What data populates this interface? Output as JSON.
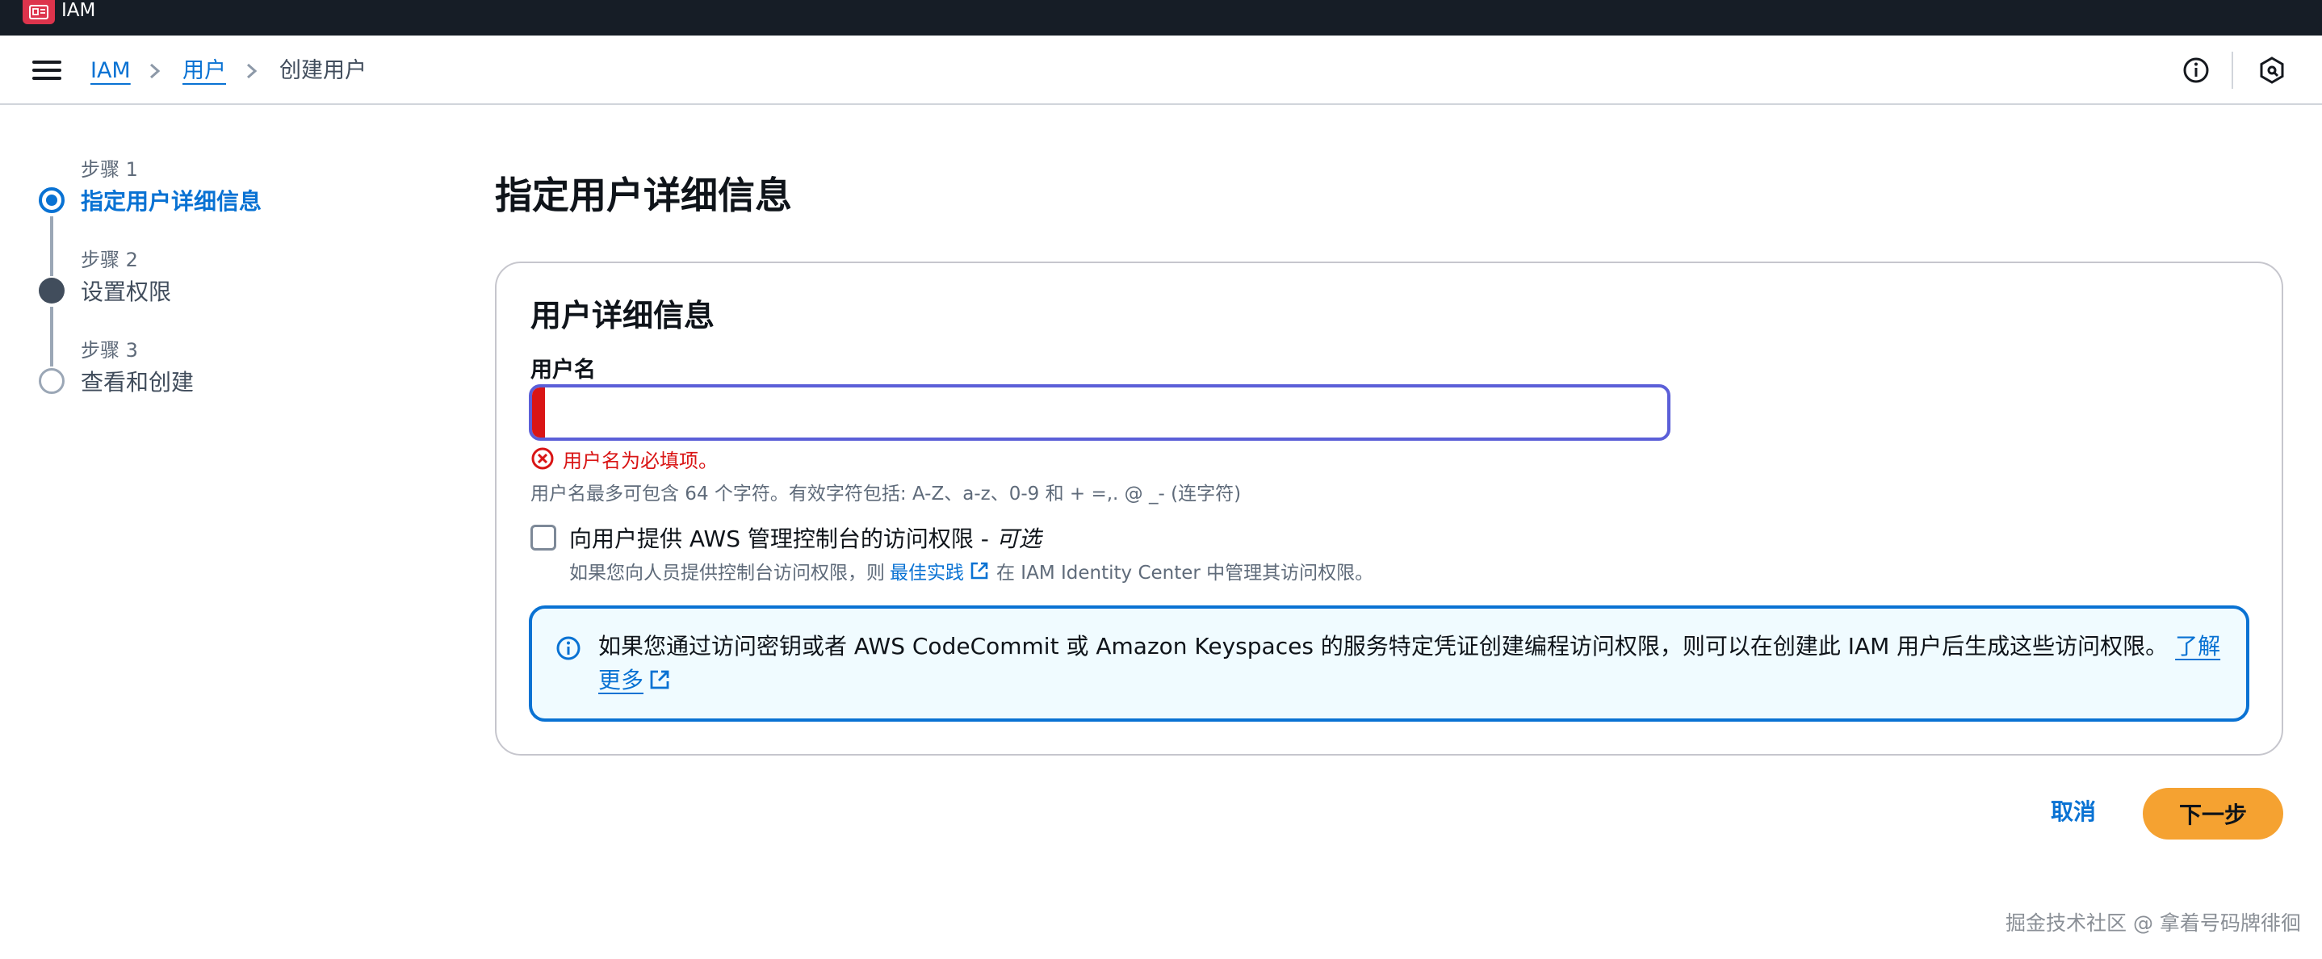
{
  "app": {
    "name": "IAM",
    "logo_icon": "iam-logo-icon"
  },
  "breadcrumb": {
    "items": [
      "IAM",
      "用户"
    ],
    "current": "创建用户"
  },
  "steps": [
    {
      "number": "步骤 1",
      "label": "指定用户详细信息",
      "state": "active"
    },
    {
      "number": "步骤 2",
      "label": "设置权限",
      "state": "visited"
    },
    {
      "number": "步骤 3",
      "label": "查看和创建",
      "state": "pending"
    }
  ],
  "page_title": "指定用户详细信息",
  "container": {
    "title": "用户详细信息",
    "username_label": "用户名",
    "username_value": "",
    "error_text": "用户名为必填项。",
    "constraint_text": "用户名最多可包含 64 个字符。有效字符包括: A-Z、a-z、0-9 和 + =,. @ _- (连字符)",
    "console_access_label": "向用户提供 AWS 管理控制台的访问权限 - ",
    "console_access_optional": "可选",
    "console_access_desc_before": "如果您向人员提供控制台访问权限，则",
    "console_access_link": "最佳实践",
    "console_access_desc_after": "在 IAM Identity Center 中管理其访问权限。",
    "info_text": "如果您通过访问密钥或者 AWS CodeCommit 或 Amazon Keyspaces 的服务特定凭证创建编程访问权限，则可以在创建此 IAM 用户后生成这些访问权限。",
    "info_link": "了解更多"
  },
  "actions": {
    "cancel": "取消",
    "next": "下一步"
  },
  "watermark": "掘金技术社区 @ 拿着号码牌徘徊",
  "colors": {
    "accent": "#0972d3",
    "error": "#d91515",
    "primary_button": "#f5a231",
    "topbar": "#161d26"
  }
}
